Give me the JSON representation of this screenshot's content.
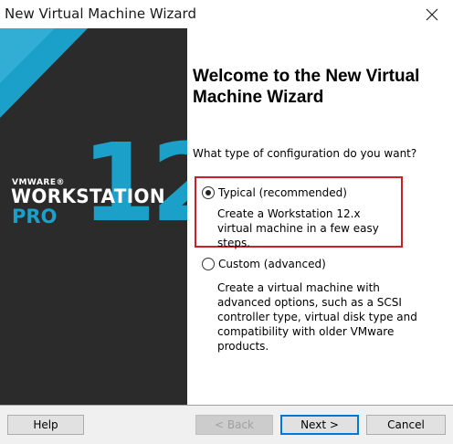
{
  "window": {
    "title": "New Virtual Machine Wizard",
    "close_icon": "close-icon"
  },
  "banner": {
    "brand": "VMWARE®",
    "product": "WORKSTATION",
    "edition": "PRO",
    "version": "12",
    "colors": {
      "background": "#2b2b2b",
      "accent": "#1ba0c9"
    }
  },
  "content": {
    "heading": "Welcome to the New Virtual Machine Wizard",
    "question": "What type of configuration do you want?",
    "options": [
      {
        "label": "Typical (recommended)",
        "description": "Create a Workstation 12.x virtual machine in a few easy steps.",
        "selected": true
      },
      {
        "label": "Custom (advanced)",
        "description": "Create a virtual machine with advanced options, such as a SCSI controller type, virtual disk type and compatibility with older VMware products.",
        "selected": false
      }
    ],
    "highlight_color": "#cc1f2a"
  },
  "buttons": {
    "help": "Help",
    "back": "< Back",
    "next": "Next >",
    "cancel": "Cancel"
  }
}
